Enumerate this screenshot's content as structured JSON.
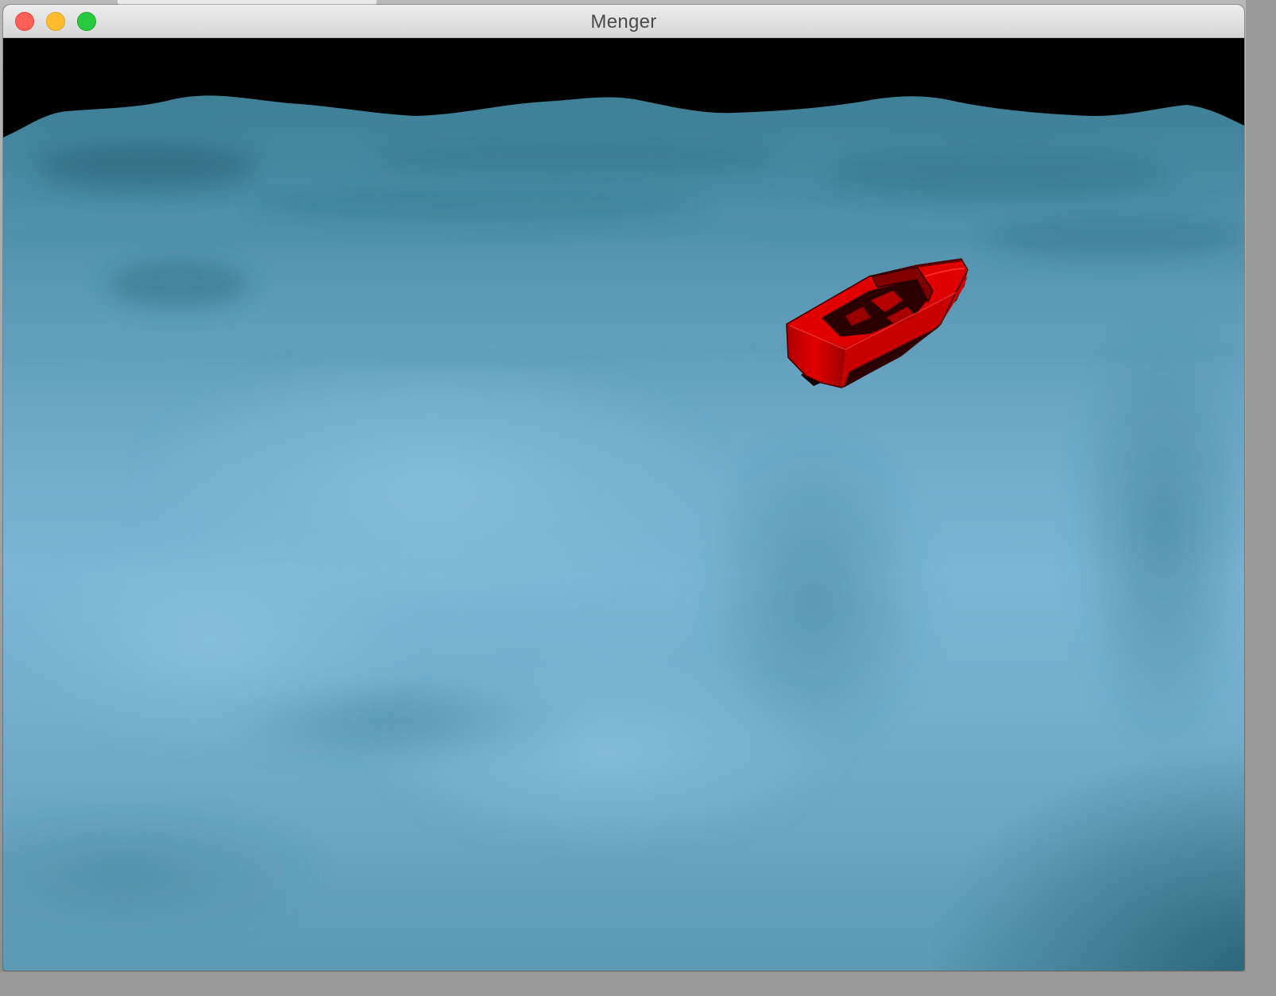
{
  "window": {
    "title": "Menger"
  },
  "scene": {
    "sky_color": "#000000",
    "water_color_light": "#80b9d9",
    "water_color_mid": "#5e9ab6",
    "water_color_dark": "#2d6c82",
    "boat_color": "#d40000"
  }
}
